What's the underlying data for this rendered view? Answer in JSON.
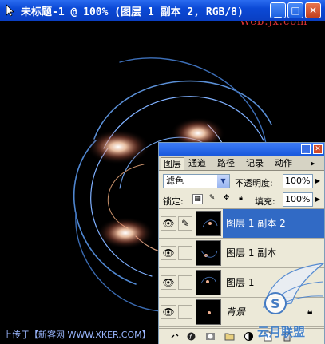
{
  "window": {
    "title": "未标题-1 @ 100% (图层 1 副本 2, RGB/8)",
    "buttons": {
      "minimize": "_",
      "maximize": "□",
      "close": "✕"
    }
  },
  "watermark_top": "Web.jx.com",
  "status_text": "上传于【新客网 WWW.XKER.COM】",
  "palette": {
    "tabs": [
      "图层",
      "通道",
      "路径",
      "记录",
      "动作"
    ],
    "blend_mode": "滤色",
    "opacity_label": "不透明度:",
    "opacity_value": "100%",
    "lock_label": "锁定:",
    "fill_label": "填充:",
    "fill_value": "100%",
    "layers": [
      {
        "name": "图层 1 副本 2",
        "selected": true,
        "brush": true
      },
      {
        "name": "图层 1 副本",
        "selected": false,
        "brush": false
      },
      {
        "name": "图层 1",
        "selected": false,
        "brush": false
      },
      {
        "name": "背景",
        "selected": false,
        "brush": false,
        "italic": true,
        "locked": true
      }
    ],
    "footer_icons": [
      "link-icon",
      "layer-style-icon",
      "mask-icon",
      "new-set-icon",
      "adjustment-icon",
      "new-layer-icon",
      "trash-icon"
    ]
  },
  "watermark_bottom": "云月联盟",
  "colors": {
    "titlebar": "#0b49d6",
    "selection": "#316ac5",
    "panel": "#ece9d8"
  }
}
